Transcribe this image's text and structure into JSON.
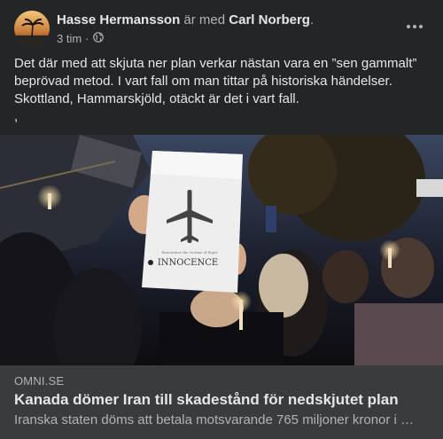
{
  "post": {
    "author": "Hasse Hermansson",
    "with_text": "är med",
    "tagged": "Carl Norberg",
    "tagged_suffix": ".",
    "time": "3 tim",
    "separator": "·",
    "privacy_icon": "globe-icon",
    "more_icon": "more-horizontal-icon",
    "text_line1": "Det där med att skjuta ner plan verkar nästan vara en ”sen gammalt”",
    "text_line2": "beprövad metod. I vart fall om man tittar på historiska händelser.",
    "text_line3": "Skottland, Hammarskjöld, otäckt är det i vart fall.",
    "text_line4": ","
  },
  "photo": {
    "sign_text": "INNOCENCE",
    "sign_small_text": "Remember the victims of flight"
  },
  "link": {
    "domain": "OMNI.SE",
    "headline": "Kanada dömer Iran till skadestånd för nedskjutet plan",
    "description": "Iranska staten döms att betala motsvarande 765 miljoner kronor i …"
  },
  "colors": {
    "background": "#242526",
    "link_box": "#3a3b3c",
    "text_primary": "#e4e6eb",
    "text_secondary": "#b0b3b8"
  }
}
